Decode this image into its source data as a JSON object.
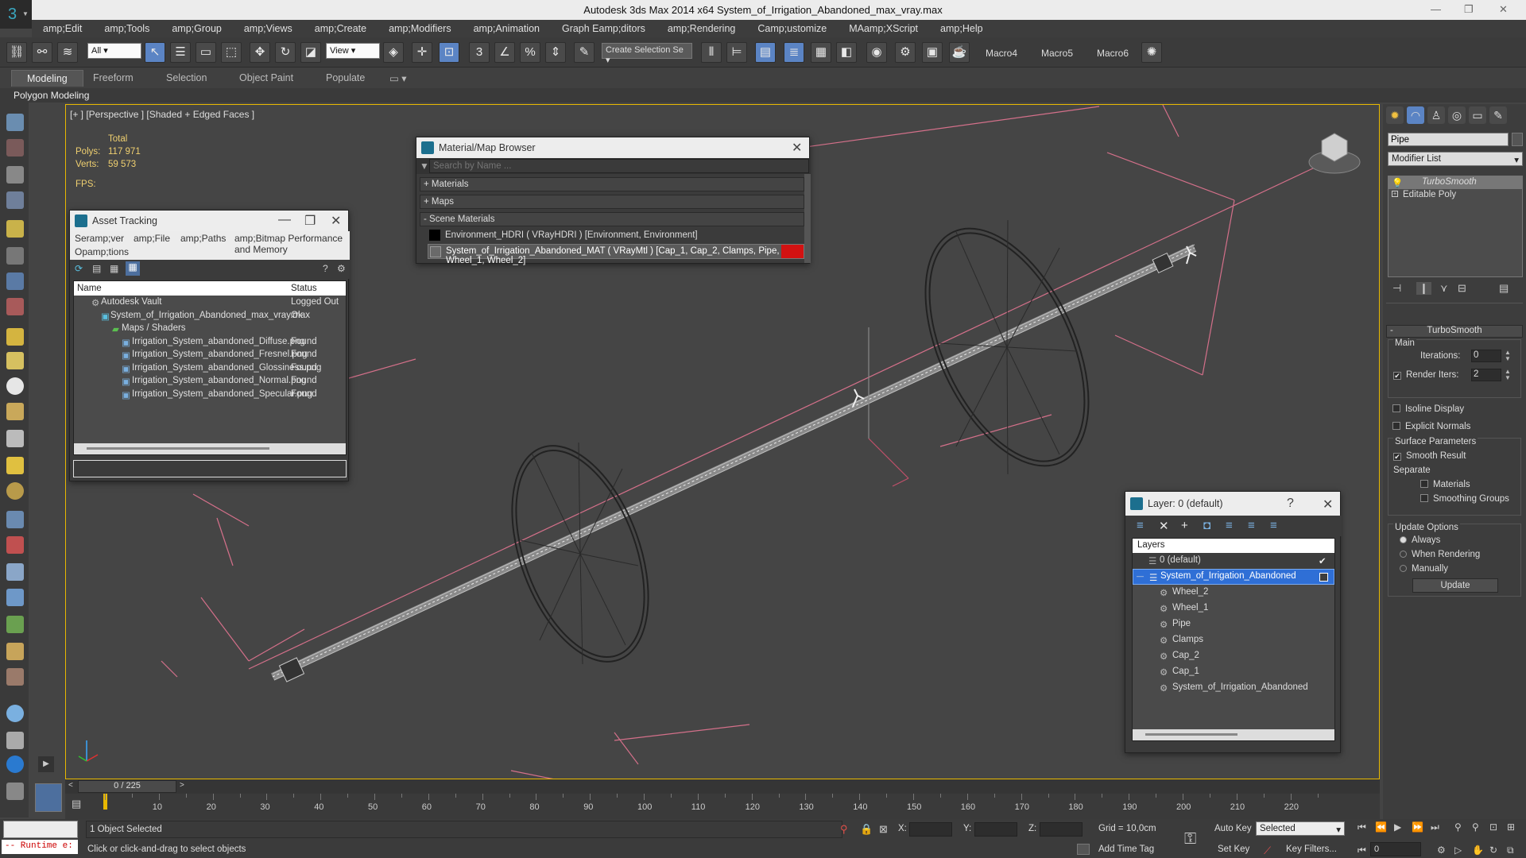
{
  "app": {
    "title": "Autodesk 3ds Max  2014 x64     System_of_Irrigation_Abandoned_max_vray.max"
  },
  "menu": [
    "amp;Edit",
    "amp;Tools",
    "amp;Group",
    "amp;Views",
    "amp;Create",
    "amp;Modifiers",
    "amp;Animation",
    "Graph Eamp;ditors",
    "amp;Rendering",
    "Camp;ustomize",
    "MAamp;XScript",
    "amp;Help"
  ],
  "toolbar": {
    "filter_value": "All",
    "refcoord_value": "View",
    "selection_set_placeholder": "Create Selection Se",
    "macros": [
      "Macro4",
      "Macro5",
      "Macro6"
    ]
  },
  "ribbon": {
    "tabs": [
      "Modeling",
      "Freeform",
      "Selection",
      "Object Paint",
      "Populate"
    ],
    "active": "Modeling",
    "subpanel": "Polygon Modeling"
  },
  "viewport": {
    "label": "[+ ] [Perspective ] [Shaded + Edged Faces ]",
    "stats_header": "Total",
    "polys_label": "Polys:",
    "polys_value": "117 971",
    "verts_label": "Verts:",
    "verts_value": "59 573",
    "fps_label": "FPS:"
  },
  "material_browser": {
    "title": "Material/Map Browser",
    "search_placeholder": "Search by Name ...",
    "groups": [
      "+ Materials",
      "+ Maps",
      "- Scene Materials"
    ],
    "items": [
      "Environment_HDRI  ( VRayHDRI )  [Environment, Environment]",
      "System_of_Irrigation_Abandoned_MAT  ( VRayMtl )  [Cap_1, Cap_2, Clamps, Pipe, Wheel_1, Wheel_2]"
    ],
    "accent_color": "#d31212"
  },
  "asset_tracking": {
    "title": "Asset Tracking",
    "menu": [
      "Seramp;ver",
      "amp;File",
      "amp;Paths",
      "amp;Bitmap Performance and Memory",
      "Opamp;tions"
    ],
    "columns": [
      "Name",
      "Status"
    ],
    "rows": [
      {
        "name": "Autodesk Vault",
        "status": "Logged Out ..."
      },
      {
        "name": "System_of_Irrigation_Abandoned_max_vray.max",
        "status": "Ok"
      },
      {
        "name": "Maps / Shaders",
        "status": ""
      },
      {
        "name": "Irrigation_System_abandoned_Diffuse.png",
        "status": "Found"
      },
      {
        "name": "Irrigation_System_abandoned_Fresnel.png",
        "status": "Found"
      },
      {
        "name": "Irrigation_System_abandoned_Glossiness.png",
        "status": "Found"
      },
      {
        "name": "Irrigation_System_abandoned_Normal.png",
        "status": "Found"
      },
      {
        "name": "Irrigation_System_abandoned_Specular.png",
        "status": "Found"
      }
    ]
  },
  "layer_dialog": {
    "title": "Layer: 0 (default)",
    "header": "Layers",
    "items": [
      "0 (default)",
      "System_of_Irrigation_Abandoned",
      "Wheel_2",
      "Wheel_1",
      "Pipe",
      "Clamps",
      "Cap_2",
      "Cap_1",
      "System_of_Irrigation_Abandoned"
    ],
    "highlight_color": "#2f6fd6"
  },
  "command_panel": {
    "object_name": "Pipe",
    "modifier_list": "Modifier List",
    "stack": [
      "TurboSmooth",
      "Editable Poly"
    ],
    "rollout_title": "TurboSmooth",
    "main_label": "Main",
    "iterations_label": "Iterations:",
    "iterations_value": "0",
    "render_iters_label": "Render Iters:",
    "render_iters_value": "2",
    "isoline": "Isoline Display",
    "explicit": "Explicit Normals",
    "surface_params": "Surface Parameters",
    "smooth_result": "Smooth Result",
    "separate": "Separate",
    "materials": "Materials",
    "smoothing_groups": "Smoothing Groups",
    "update_options": "Update Options",
    "always": "Always",
    "when_rendering": "When Rendering",
    "manually": "Manually",
    "update_button": "Update"
  },
  "timeline": {
    "frame_display": "0 / 225",
    "ticks": [
      "10",
      "20",
      "30",
      "40",
      "50",
      "60",
      "70",
      "80",
      "90",
      "100",
      "110",
      "120",
      "130",
      "140",
      "150",
      "160",
      "170",
      "180",
      "190",
      "200",
      "210",
      "220"
    ]
  },
  "status": {
    "script_label": "-- Runtime e:",
    "selected_text": "1 Object Selected",
    "prompt": "Click or click-and-drag to select objects",
    "x_label": "X:",
    "y_label": "Y:",
    "z_label": "Z:",
    "grid": "Grid = 10,0cm",
    "add_time_tag": "Add Time Tag",
    "auto_key": "Auto Key",
    "set_key": "Set Key",
    "selected_dropdown": "Selected",
    "key_filters": "Key Filters...",
    "frame_field": "0"
  }
}
